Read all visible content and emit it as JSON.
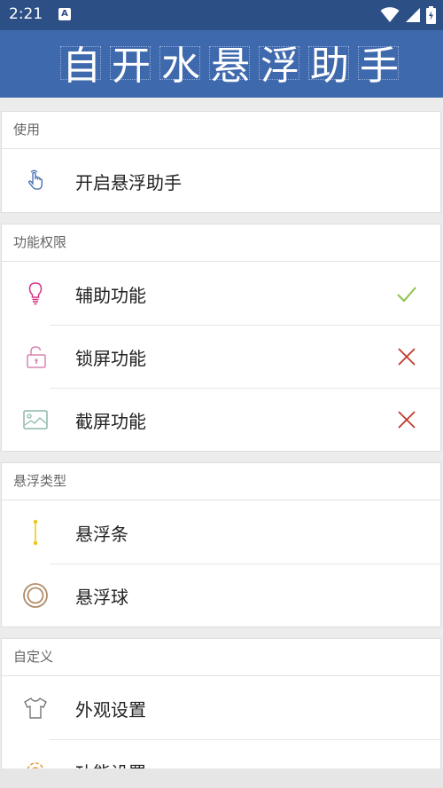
{
  "status_bar": {
    "time": "2:21",
    "notification_letter": "A",
    "icons": [
      "wifi-icon",
      "signal-icon",
      "battery-icon"
    ]
  },
  "header": {
    "title_chars": [
      "自",
      "开",
      "水",
      "悬",
      "浮",
      "助",
      "手"
    ]
  },
  "sections": [
    {
      "title": "使用",
      "items": [
        {
          "label": "开启悬浮助手",
          "icon": "hand-tap-icon"
        }
      ]
    },
    {
      "title": "功能权限",
      "items": [
        {
          "label": "辅助功能",
          "icon": "lightbulb-icon",
          "status": "enabled"
        },
        {
          "label": "锁屏功能",
          "icon": "lock-icon",
          "status": "disabled"
        },
        {
          "label": "截屏功能",
          "icon": "image-icon",
          "status": "disabled"
        }
      ]
    },
    {
      "title": "悬浮类型",
      "items": [
        {
          "label": "悬浮条",
          "icon": "floating-bar-icon"
        },
        {
          "label": "悬浮球",
          "icon": "floating-ball-icon"
        }
      ]
    },
    {
      "title": "自定义",
      "items": [
        {
          "label": "外观设置",
          "icon": "tshirt-icon"
        },
        {
          "label": "功能设置",
          "icon": "gear-icon"
        }
      ]
    }
  ],
  "colors": {
    "status_bar": "#2c4f86",
    "header": "#3f69ad",
    "check": "#8bc34a",
    "cross": "#c0392b"
  }
}
